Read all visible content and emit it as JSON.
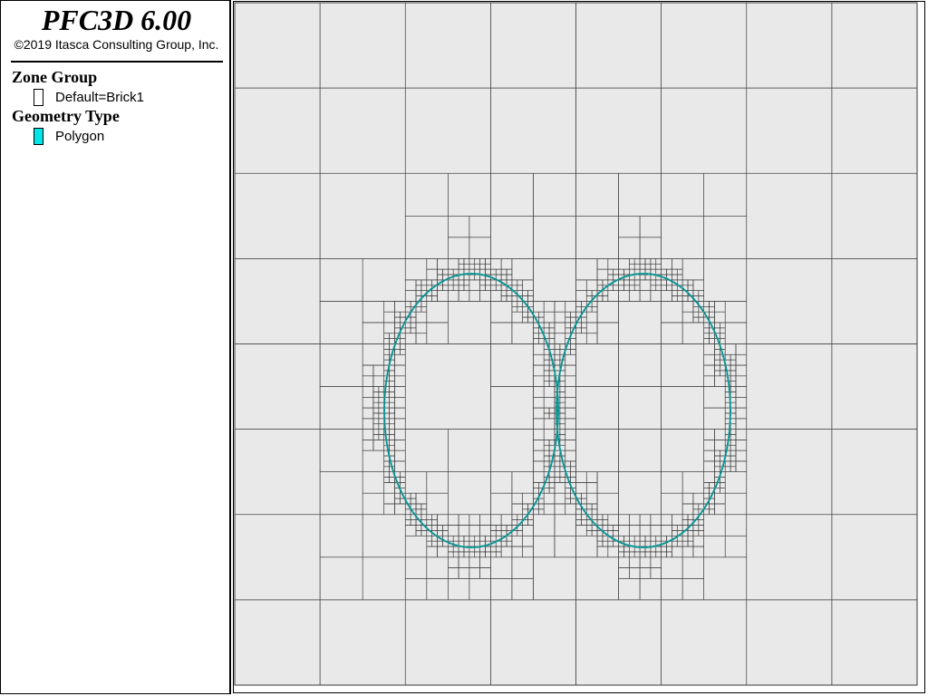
{
  "legend": {
    "title": "PFC3D 6.00",
    "copyright": "©2019 Itasca Consulting Group, Inc.",
    "sections": [
      {
        "heading": "Zone Group",
        "items": [
          {
            "label": "Default=Brick1",
            "swatch": "#ffffff"
          }
        ]
      },
      {
        "heading": "Geometry Type",
        "items": [
          {
            "label": "Polygon",
            "swatch": "#00e5e5"
          }
        ]
      }
    ]
  },
  "colors": {
    "zone_fill": "#e9e9e9",
    "grid_line": "#3a3a3a",
    "polygon": "#13a3a3",
    "polygon_dark": "#0b5a5a"
  }
}
